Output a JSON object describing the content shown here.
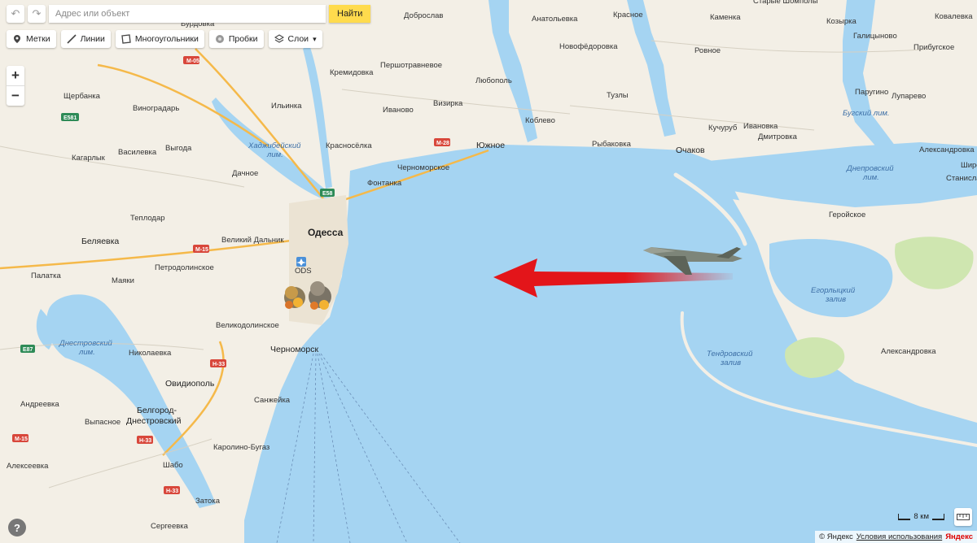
{
  "search": {
    "placeholder": "Адрес или объект",
    "button": "Найти"
  },
  "toolbar": {
    "tools": [
      "Метки",
      "Линии",
      "Многоугольники",
      "Пробки",
      "Слои"
    ]
  },
  "zoom": {
    "in": "+",
    "out": "−"
  },
  "help": "?",
  "scale": {
    "label": "8 км"
  },
  "footer": {
    "copyright": "© Яндекс",
    "terms": "Условия использования",
    "brand": "Яндекс"
  },
  "cities": {
    "odessa": "Одесса",
    "yuzhnoe": "Южное",
    "ochakov": "Очаков",
    "chernomorsk": "Черноморск",
    "belyaevka": "Беляевка",
    "ovidiopol": "Овидиополь",
    "belgorod": "Белгород-\nДнестровский"
  },
  "places": [
    "Старые Шомполы",
    "Бурдовка",
    "Доброслав",
    "Анатольевка",
    "Красное",
    "Каменка",
    "Козырка",
    "Ковалевка",
    "Новофёдоровка",
    "Галицыново",
    "Прибугское",
    "Ровное",
    "Першотравневое",
    "Кремидовка",
    "Любополь",
    "Щербанка",
    "Виноградарь",
    "Ильинка",
    "Иваново",
    "Визирка",
    "Тузлы",
    "Паругино",
    "Лупарево",
    "Коблево",
    "Кагарлык",
    "Василевка",
    "Выгода",
    "Красносёлка",
    "Рыбаковка",
    "Кучуруб",
    "Ивановка",
    "Дмитровка",
    "Александровка",
    "Широ",
    "Дачное",
    "Черноморское",
    "Фонтанка",
    "Станислав",
    "Теплодар",
    "Геройское",
    "Великий Дальник",
    "Петродолинское",
    "Палатка",
    "Маяки",
    "Великодолинское",
    "Николаевка",
    "Андреевка",
    "Санжейка",
    "Выпасное",
    "Алексеевка",
    "Каролино-Бугаз",
    "Шабо",
    "Затока",
    "Сергеевка",
    "Александровка",
    "ODS"
  ],
  "water": {
    "khadzhibey": "Хаджибейский\nлим.",
    "dniester": "Днестровский\nлим.",
    "dnieper": "Днепровский\nлим.",
    "bug": "Бугский лим.",
    "egorlyk": "Егорлыцкий\nзалив",
    "tendra": "Тендровский\nзалив"
  },
  "roads": [
    "M-05",
    "E581",
    "M-28",
    "E58",
    "M-15",
    "E87",
    "H-33",
    "M-15",
    "H-33",
    "H-33"
  ],
  "icons": {
    "drone": "drone-icon",
    "arrow": "attack-arrow",
    "explosion": "explosion-icon"
  },
  "colors": {
    "sea": "#a5d4f2",
    "land": "#f3efe6",
    "arrow": "#e3151a",
    "find_button": "#ffdb4d"
  }
}
